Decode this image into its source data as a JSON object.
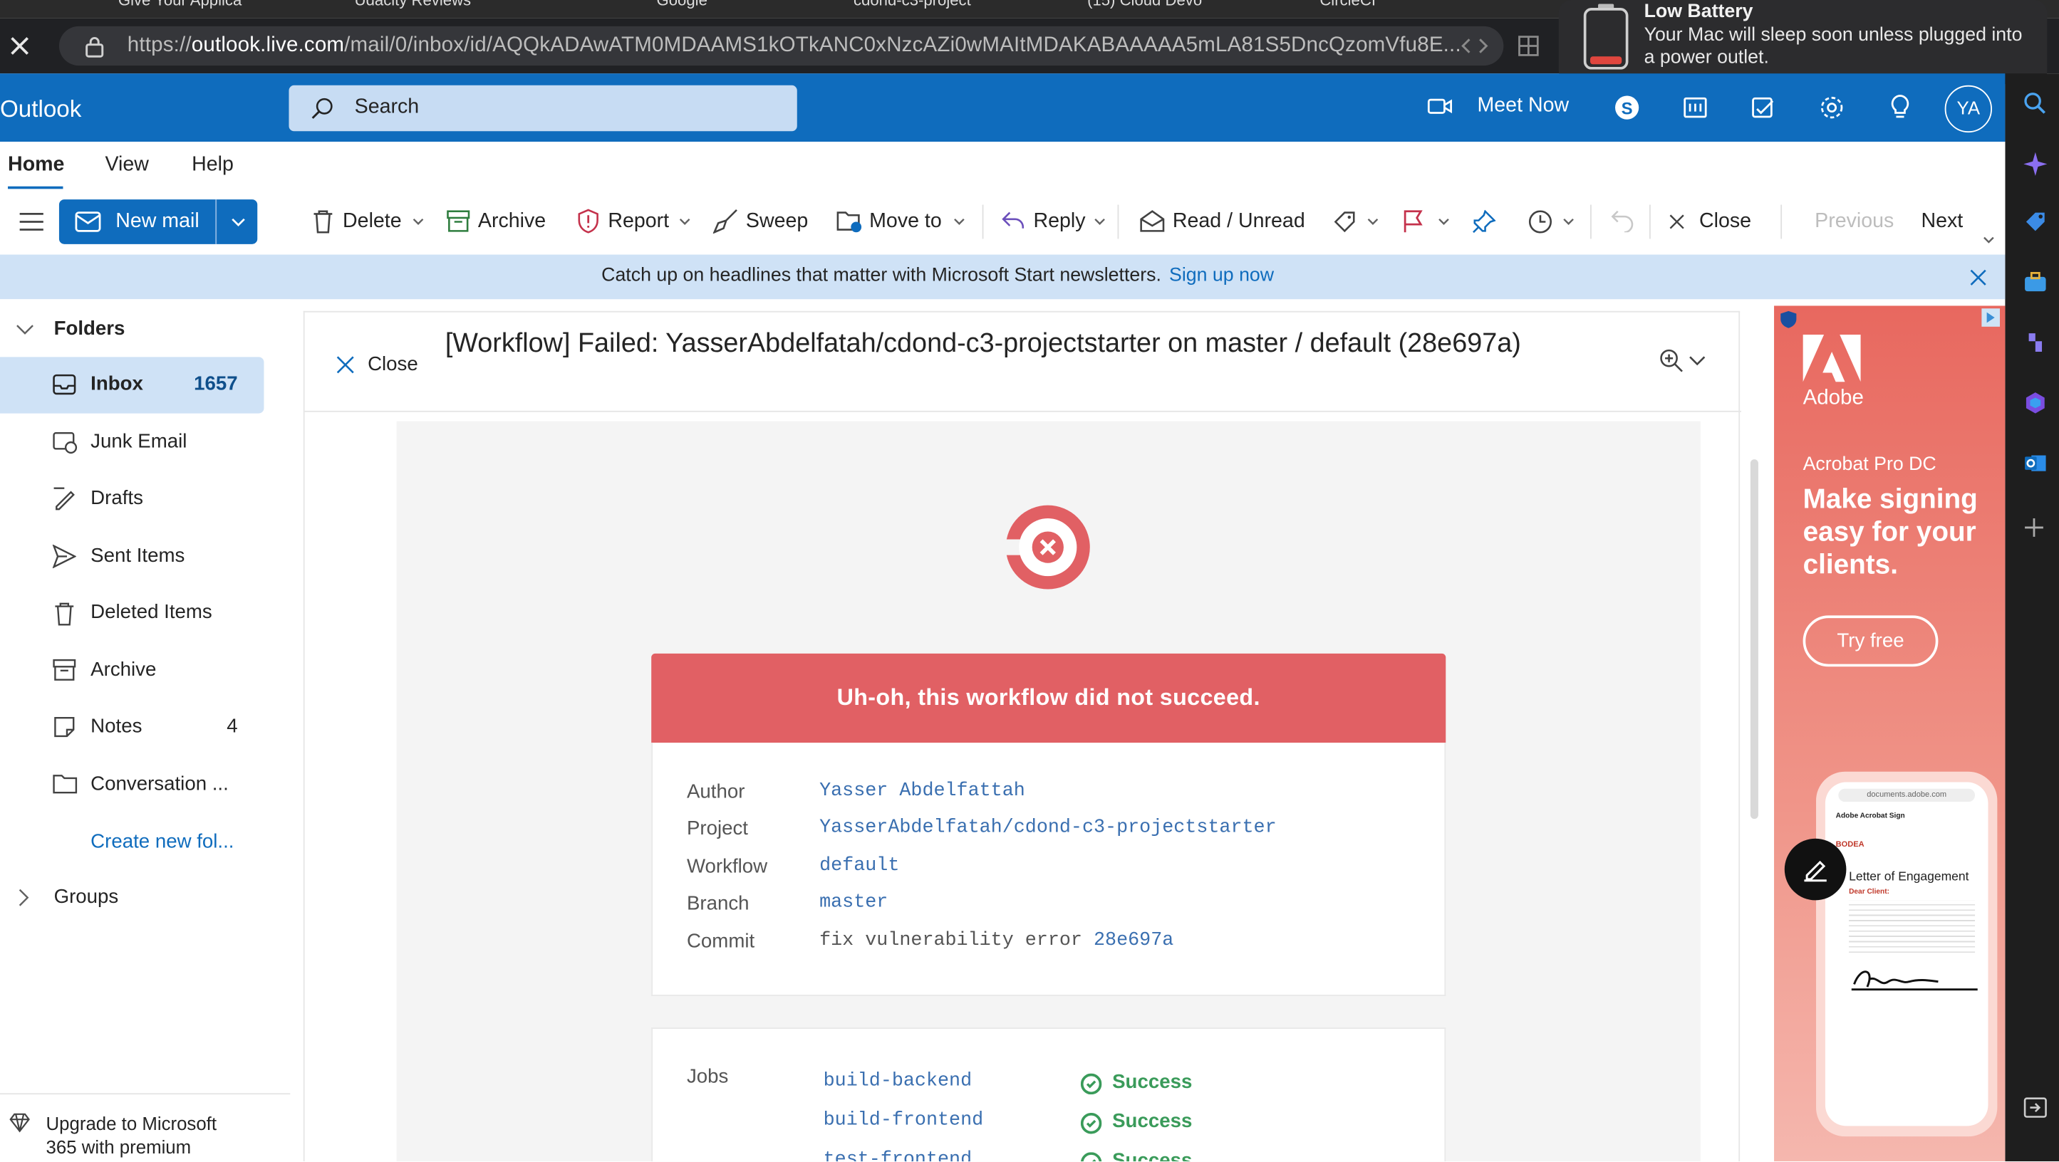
{
  "browser": {
    "tabs": [
      "Give Your Applica",
      "Udacity Reviews",
      "Google",
      "cdond-c3-project",
      "(15) Cloud Devo",
      "CircleCI"
    ],
    "url_prefix": "https://",
    "url_host": "outlook.live.com",
    "url_path": "/mail/0/inbox/id/AQQkADAwATM0MDAAMS1kOTkANC0xNzcAZi0wMAItMDAKABAAAAA5mLA81S5DncQzomVfu8E..."
  },
  "notification": {
    "title": "Low Battery",
    "body": "Your Mac will sleep soon unless plugged into a power outlet."
  },
  "header": {
    "brand": "Outlook",
    "search_placeholder": "Search",
    "meet_now": "Meet Now",
    "avatar_initials": "YA"
  },
  "ribbon_tabs": [
    "Home",
    "View",
    "Help"
  ],
  "toolbar": {
    "new_mail": "New mail",
    "delete": "Delete",
    "archive": "Archive",
    "report": "Report",
    "sweep": "Sweep",
    "move_to": "Move to",
    "reply": "Reply",
    "read_unread": "Read / Unread",
    "close": "Close",
    "previous": "Previous",
    "next": "Next"
  },
  "banner": {
    "text": "Catch up on headlines that matter with Microsoft Start newsletters.",
    "link": "Sign up now"
  },
  "folders": {
    "title": "Folders",
    "items": [
      {
        "label": "Inbox",
        "count": "1657"
      },
      {
        "label": "Junk Email",
        "count": ""
      },
      {
        "label": "Drafts",
        "count": ""
      },
      {
        "label": "Sent Items",
        "count": ""
      },
      {
        "label": "Deleted Items",
        "count": ""
      },
      {
        "label": "Archive",
        "count": ""
      },
      {
        "label": "Notes",
        "count": "4"
      },
      {
        "label": "Conversation ...",
        "count": ""
      }
    ],
    "create_new": "Create new fol...",
    "groups": "Groups",
    "upgrade_line1": "Upgrade to Microsoft",
    "upgrade_line2": "365 with premium"
  },
  "message": {
    "close_label": "Close",
    "subject": "[Workflow] Failed: YasserAbdelfatah/cdond-c3-projectstarter on master / default (28e697a)",
    "fail_banner": "Uh-oh, this workflow did not succeed.",
    "details": {
      "author_label": "Author",
      "author": "Yasser Abdelfattah",
      "project_label": "Project",
      "project": "YasserAbdelfatah/cdond-c3-projectstarter",
      "workflow_label": "Workflow",
      "workflow": "default",
      "branch_label": "Branch",
      "branch": "master",
      "commit_label": "Commit",
      "commit_msg": "fix vulnerability error",
      "commit_hash": "28e697a"
    },
    "jobs_label": "Jobs",
    "jobs": [
      {
        "name": "build-backend",
        "status": "Success"
      },
      {
        "name": "build-frontend",
        "status": "Success"
      },
      {
        "name": "test-frontend",
        "status": "Success"
      }
    ]
  },
  "ad": {
    "brand": "Adobe",
    "product": "Acrobat Pro DC",
    "headline": "Make signing easy for your clients.",
    "cta": "Try free",
    "phone_url": "documents.adobe.com",
    "phone_app": "Adobe Acrobat Sign",
    "doc_title": "Letter of Engagement",
    "doc_greeting": "Dear Client:",
    "doc_logo": "BODEA"
  },
  "colors": {
    "outlook_blue": "#0f6cbd",
    "fail_red": "#e16064",
    "success_green": "#3a9b5a",
    "link_blue": "#3a6fb0"
  }
}
